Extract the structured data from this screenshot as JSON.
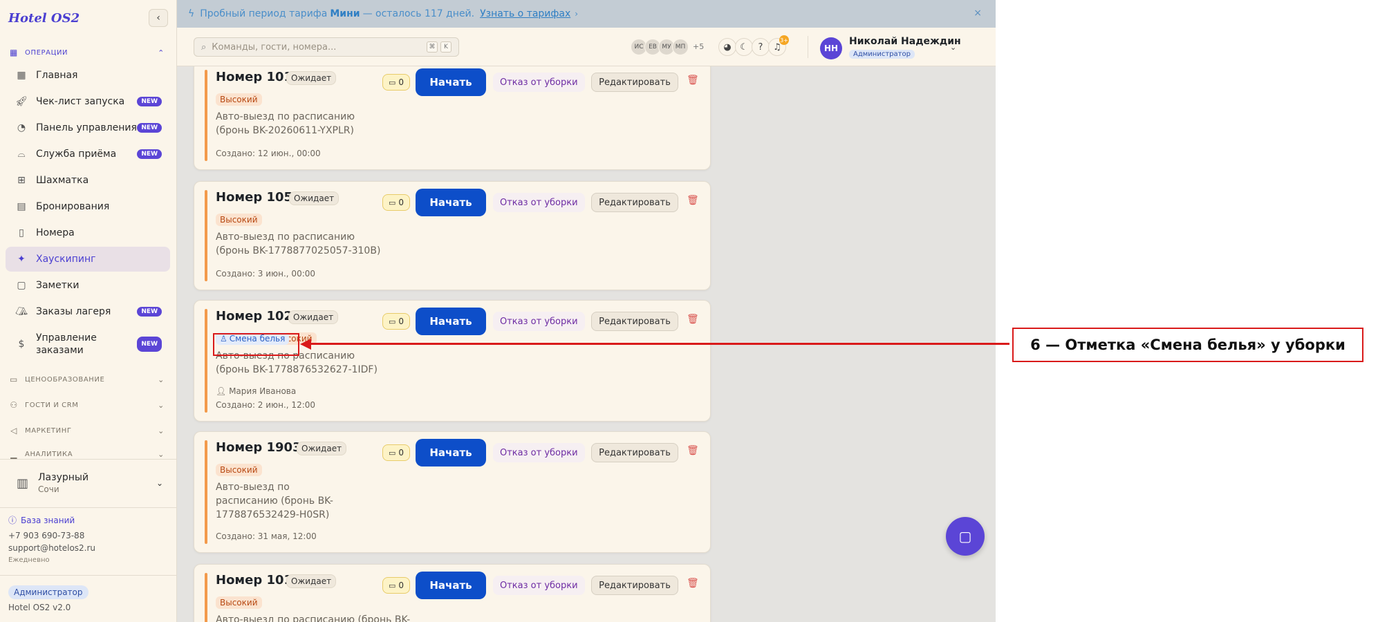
{
  "sidebar": {
    "logo": "Hotel OS2",
    "sections": {
      "operations": "ОПЕРАЦИИ",
      "pricing": "ЦЕНООБРАЗОВАНИЕ",
      "guests": "ГОСТИ И CRM",
      "marketing": "МАРКЕТИНГ",
      "analytics": "АНАЛИТИКА"
    },
    "items": [
      {
        "label": "Главная",
        "badge": "",
        "icon": "dashboard-icon"
      },
      {
        "label": "Чек-лист запуска",
        "badge": "NEW",
        "icon": "rocket-icon"
      },
      {
        "label": "Панель управления",
        "badge": "NEW",
        "icon": "gauge-icon"
      },
      {
        "label": "Служба приёма",
        "badge": "NEW",
        "icon": "bell-icon"
      },
      {
        "label": "Шахматка",
        "badge": "",
        "icon": "grid-icon"
      },
      {
        "label": "Бронирования",
        "badge": "",
        "icon": "clipboard-icon"
      },
      {
        "label": "Номера",
        "badge": "",
        "icon": "door-icon"
      },
      {
        "label": "Хаускипинг",
        "badge": "",
        "icon": "sparkle-icon"
      },
      {
        "label": "Заметки",
        "badge": "",
        "icon": "note-icon"
      },
      {
        "label": "Заказы лагеря",
        "badge": "NEW",
        "icon": "tent-icon"
      },
      {
        "label": "Управление заказами",
        "badge": "NEW",
        "icon": "receipt-icon"
      }
    ],
    "hotel": {
      "name": "Лазурный",
      "city": "Сочи"
    },
    "knowledge_base": "База знаний",
    "phone": "+7 903 690-73-88",
    "email": "support@hotelos2.ru",
    "hours": "Ежедневно",
    "role": "Администратор",
    "version": "Hotel OS2 v2.0"
  },
  "banner": {
    "text_before": "Пробный период тарифа",
    "plan": "Мини",
    "text_after": "— осталось 117 дней.",
    "link": "Узнать о тарифах",
    "arrow": "›",
    "close": "×"
  },
  "header": {
    "search_placeholder": "Команды, гости, номера...",
    "kbd_cmd": "⌘",
    "kbd_k": "K",
    "avatars": [
      "ИС",
      "ЕВ",
      "МУ",
      "МП"
    ],
    "avatars_more": "+5",
    "notif_count": "3+",
    "user_initials": "НН",
    "user_name": "Николай Надеждин",
    "user_role": "Администратор"
  },
  "tasks": [
    {
      "room": "Номер 101",
      "status": "Ожидает",
      "priority": "Высокий",
      "tag": "",
      "desc": "Авто-выезд по расписанию (бронь BK-20260611-YXPLR)",
      "assignee": "",
      "created": "Создано: 12 июн., 00:00",
      "comments": "0"
    },
    {
      "room": "Номер 105",
      "status": "Ожидает",
      "priority": "Высокий",
      "tag": "",
      "desc": "Авто-выезд по расписанию (бронь BK-1778877025057-310B)",
      "assignee": "",
      "created": "Создано: 3 июн., 00:00",
      "comments": "0"
    },
    {
      "room": "Номер 102",
      "status": "Ожидает",
      "priority": "Высокий",
      "tag": "Смена белья",
      "desc": "Авто-выезд по расписанию (бронь BK-1778876532627-1IDF)",
      "assignee": "Мария Иванова",
      "created": "Создано: 2 июн., 12:00",
      "comments": "0"
    },
    {
      "room": "Номер 1903",
      "status": "Ожидает",
      "priority": "Высокий",
      "tag": "",
      "desc": "Авто-выезд по расписанию (бронь BK-1778876532429-H0SR)",
      "assignee": "",
      "created": "Создано: 31 мая, 12:00",
      "comments": "0"
    },
    {
      "room": "Номер 101",
      "status": "Ожидает",
      "priority": "Высокий",
      "tag": "",
      "desc": "Авто-выезд по расписанию (бронь BK-",
      "assignee": "",
      "created": "",
      "comments": "0"
    }
  ],
  "actions": {
    "start": "Начать",
    "refuse": "Отказ от уборки",
    "edit": "Редактировать"
  },
  "annotation": {
    "label": "6 — Отметка «Смена белья» у уборки"
  }
}
